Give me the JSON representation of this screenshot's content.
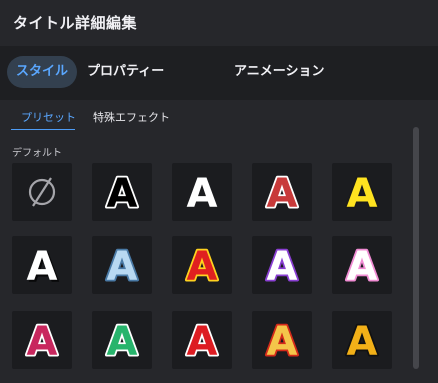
{
  "header": {
    "title": "タイトル詳細編集"
  },
  "tabs": [
    {
      "label": "スタイル",
      "active": true
    },
    {
      "label": "プロパティー",
      "active": false
    },
    {
      "label": "アニメーション",
      "active": false
    }
  ],
  "subtabs": [
    {
      "label": "プリセット",
      "active": true
    },
    {
      "label": "特殊エフェクト",
      "active": false
    }
  ],
  "section": {
    "label": "デフォルト"
  },
  "preset_letter": "A",
  "presets": [
    {
      "id": "none",
      "icon": "empty-set-icon"
    },
    {
      "id": "outline-white",
      "fill": "#000000",
      "stroke": "#ffffff"
    },
    {
      "id": "plain-white",
      "fill": "#ffffff"
    },
    {
      "id": "red-white-outline",
      "fill": "#c83a3a",
      "stroke": "#ffffff"
    },
    {
      "id": "yellow-black-outline",
      "fill": "#ffe320",
      "stroke": "#1a1a1a"
    },
    {
      "id": "white-shadow",
      "fill": "#ffffff",
      "shadow": "#000000"
    },
    {
      "id": "light-blue",
      "fill": "#b8d9f2",
      "stroke": "#4a7aa6"
    },
    {
      "id": "red-yellow-outline",
      "fill": "#e02020",
      "stroke": "#ffd21f"
    },
    {
      "id": "white-purple-outline",
      "fill": "#ffffff",
      "stroke": "#8a3fd2"
    },
    {
      "id": "white-pink-outline",
      "fill": "#ffffff",
      "stroke": "#f08cd3"
    },
    {
      "id": "crimson-white-outline",
      "fill": "#c8275e",
      "stroke": "#ffffff"
    },
    {
      "id": "green-white-outline",
      "fill": "#27b46c",
      "stroke": "#ffffff"
    },
    {
      "id": "red-white-thick",
      "fill": "#dd1c22",
      "stroke": "#ffffff"
    },
    {
      "id": "gold-red-outline",
      "fill": "#f4c64a",
      "stroke": "#d42a1a"
    },
    {
      "id": "gold-black-outline",
      "fill": "#f2b018",
      "stroke": "#111111"
    }
  ]
}
